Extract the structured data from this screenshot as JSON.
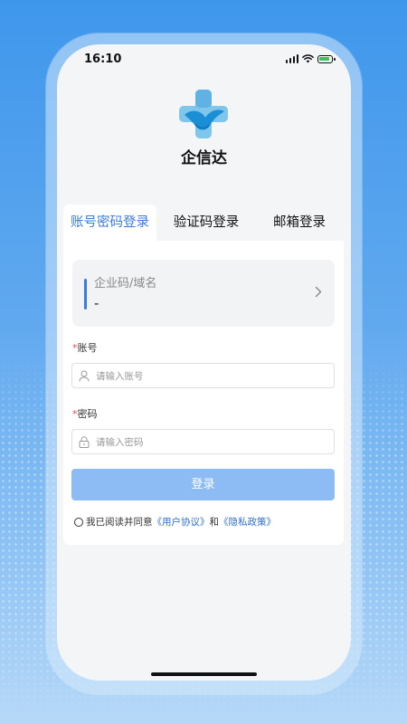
{
  "status_bar": {
    "time": "16:10"
  },
  "app": {
    "name": "企信达"
  },
  "tabs": [
    {
      "label": "账号密码登录",
      "active": true
    },
    {
      "label": "验证码登录",
      "active": false
    },
    {
      "label": "邮箱登录",
      "active": false
    }
  ],
  "domain": {
    "label": "企业码/域名",
    "value": "-"
  },
  "account": {
    "required_mark": "*",
    "label": "账号",
    "placeholder": "请输入账号"
  },
  "password": {
    "required_mark": "*",
    "label": "密码",
    "placeholder": "请输入密码"
  },
  "login_button": {
    "label": "登录"
  },
  "agreement": {
    "prefix": "我已阅读并同意",
    "user_agreement": "《用户协议》",
    "and": "和",
    "privacy_policy": "《隐私政策》"
  },
  "colors": {
    "accent": "#3b7ae0",
    "button_disabled": "#8dbcf4",
    "background": "#3f97ec",
    "required": "#e34d4d"
  }
}
